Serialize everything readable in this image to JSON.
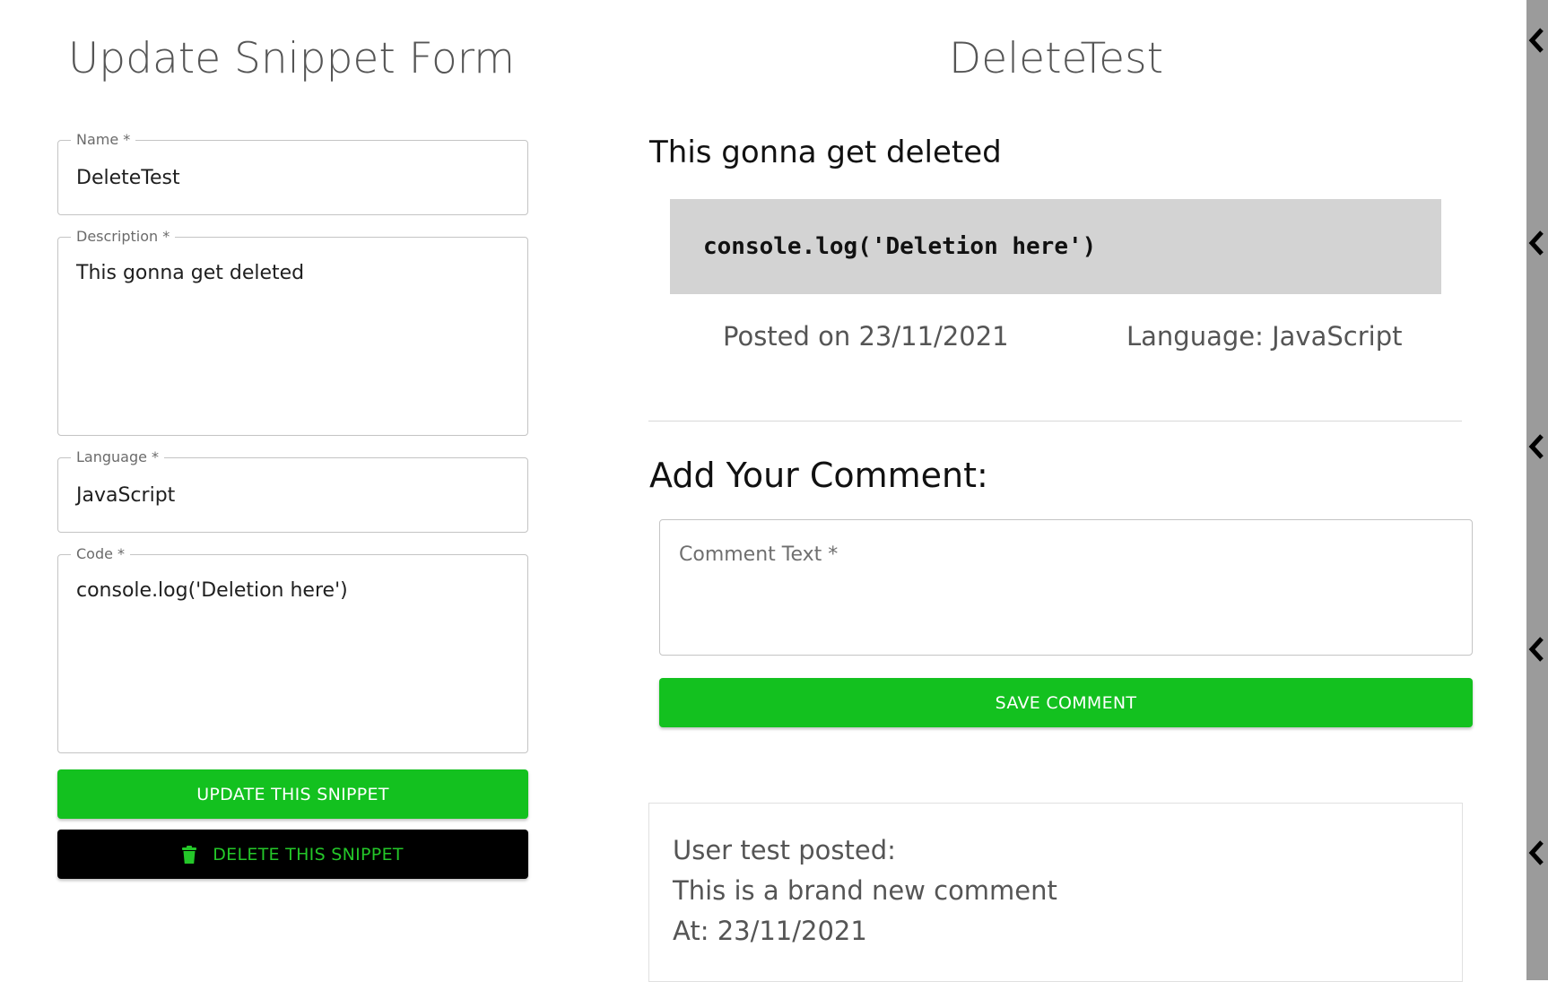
{
  "update_form": {
    "title": "Update Snippet Form",
    "name_label": "Name *",
    "name_value": "DeleteTest",
    "description_label": "Description *",
    "description_value": "This gonna get deleted",
    "language_label": "Language *",
    "language_value": "JavaScript",
    "code_label": "Code *",
    "code_value": "console.log('Deletion here')",
    "update_button": "UPDATE THIS SNIPPET",
    "delete_button": "DELETE THIS SNIPPET",
    "delete_icon": "trash-icon"
  },
  "snippet": {
    "title": "DeleteTest",
    "description": "This gonna get deleted",
    "code": "console.log('Deletion here')",
    "posted": "Posted on 23/11/2021",
    "language": "Language: JavaScript"
  },
  "comment_form": {
    "heading": "Add Your Comment:",
    "placeholder": "Comment Text *",
    "save_button": "SAVE COMMENT"
  },
  "comments": [
    {
      "author_line": "User test posted:",
      "text": "This is a brand new comment",
      "date_line": "At: 23/11/2021"
    }
  ],
  "colors": {
    "accent_green": "#13c11f",
    "delete_bg": "#000000",
    "delete_text": "#24c729",
    "code_bg": "#d3d3d3"
  },
  "edge_icons": "chevron-left-icon"
}
